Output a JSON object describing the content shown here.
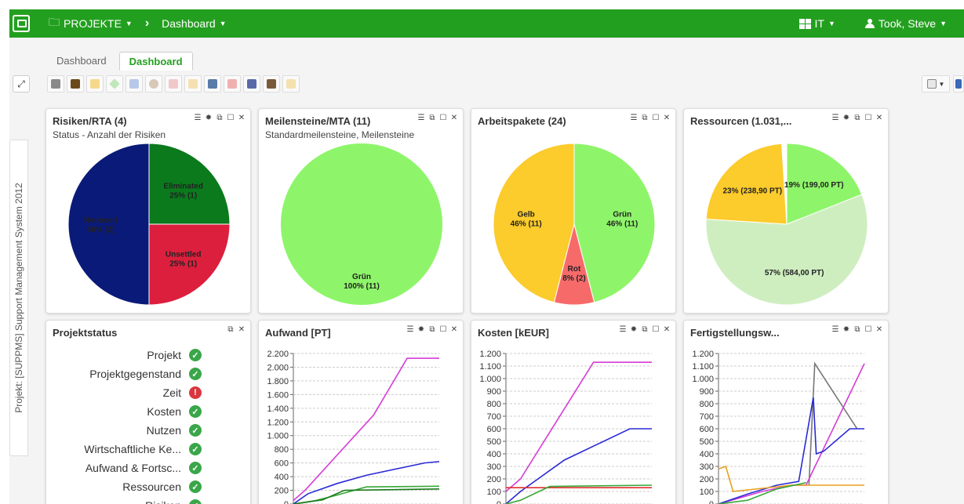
{
  "topbar": {
    "projects": "PROJEKTE",
    "dashboard": "Dashboard",
    "it": "IT",
    "user": "Took, Steve"
  },
  "tabs": [
    "Dashboard",
    "Dashboard"
  ],
  "side_tab": "Projekt: [SUPPMS] Support Management System 2012",
  "widgets": {
    "risks": {
      "title": "Risiken/RTA (4)",
      "subtitle": "Status - Anzahl der Risiken"
    },
    "milestones": {
      "title": "Meilensteine/MTA (11)",
      "subtitle": "Standardmeilensteine, Meilensteine"
    },
    "workpackages": {
      "title": "Arbeitspakete (24)"
    },
    "resources": {
      "title": "Ressourcen (1.031,..."
    },
    "projectstatus": {
      "title": "Projektstatus"
    },
    "effort": {
      "title": "Aufwand [PT]"
    },
    "costs": {
      "title": "Kosten [kEUR]"
    },
    "completion": {
      "title": "Fertigstellungsw..."
    }
  },
  "pies": {
    "risks": [
      {
        "label": "Eliminated",
        "value": "25% (1)",
        "color": "#0b7a1d",
        "frac": 0.25
      },
      {
        "label": "Unsettled",
        "value": "25% (1)",
        "color": "#dc1f3d",
        "frac": 0.25
      },
      {
        "label": "Reduced",
        "value": "50% (2)",
        "color": "#0a1a78",
        "frac": 0.5
      }
    ],
    "milestones": [
      {
        "label": "Grün",
        "value": "100% (11)",
        "color": "#8ef56a",
        "frac": 1.0
      }
    ],
    "workpackages": [
      {
        "label": "Grün",
        "value": "46% (11)",
        "color": "#8ef56a",
        "frac": 0.46
      },
      {
        "label": "Rot",
        "value": "8% (2)",
        "color": "#f76a6a",
        "frac": 0.08
      },
      {
        "label": "Gelb",
        "value": "46% (11)",
        "color": "#fccb2c",
        "frac": 0.46
      }
    ],
    "resources": [
      {
        "label": "",
        "value": "19% (199,00 PT)",
        "color": "#8ef56a",
        "frac": 0.19
      },
      {
        "label": "",
        "value": "57% (584,00 PT)",
        "color": "#cfeec0",
        "frac": 0.57
      },
      {
        "label": "",
        "value": "23% (238,90 PT)",
        "color": "#fccb2c",
        "frac": 0.23
      }
    ]
  },
  "status_items": [
    {
      "label": "Projekt",
      "state": "ok"
    },
    {
      "label": "Projektgegenstand",
      "state": "ok"
    },
    {
      "label": "Zeit",
      "state": "error"
    },
    {
      "label": "Kosten",
      "state": "ok"
    },
    {
      "label": "Nutzen",
      "state": "ok"
    },
    {
      "label": "Wirtschaftliche Ke...",
      "state": "ok"
    },
    {
      "label": "Aufwand & Fortsc...",
      "state": "ok"
    },
    {
      "label": "Ressourcen",
      "state": "ok"
    },
    {
      "label": "Risiken",
      "state": "ok"
    }
  ],
  "chart_data": [
    {
      "type": "line",
      "title": "Aufwand [PT]",
      "yticks": [
        "2.200",
        "2.000",
        "1.800",
        "1.600",
        "1.400",
        "1.200",
        "1.000",
        "800",
        "600",
        "400",
        "200",
        "0"
      ],
      "ylim": [
        0,
        2200
      ],
      "series": [
        {
          "color": "#d63bd6",
          "x": [
            0,
            0.08,
            0.55,
            0.78,
            1
          ],
          "y": [
            50,
            200,
            1300,
            2130,
            2130
          ]
        },
        {
          "color": "#2a2ad6",
          "x": [
            0,
            0.1,
            0.3,
            0.5,
            0.9,
            1
          ],
          "y": [
            0,
            150,
            300,
            420,
            600,
            620
          ]
        },
        {
          "color": "#38a838",
          "x": [
            0,
            0.15,
            0.3,
            0.5,
            1
          ],
          "y": [
            0,
            50,
            130,
            250,
            260
          ]
        },
        {
          "color": "#1a7a1a",
          "x": [
            0,
            0.2,
            0.35,
            1
          ],
          "y": [
            0,
            60,
            200,
            220
          ]
        }
      ]
    },
    {
      "type": "line",
      "title": "Kosten [kEUR]",
      "yticks": [
        "1.200",
        "1.100",
        "1.000",
        "900",
        "800",
        "700",
        "600",
        "500",
        "400",
        "300",
        "200",
        "100",
        "0"
      ],
      "ylim": [
        0,
        1200
      ],
      "series": [
        {
          "color": "#d63bd6",
          "x": [
            0,
            0.1,
            0.6,
            1
          ],
          "y": [
            100,
            200,
            1130,
            1130
          ]
        },
        {
          "color": "#2a2ad6",
          "x": [
            0,
            0.1,
            0.4,
            0.85,
            1
          ],
          "y": [
            0,
            100,
            350,
            600,
            600
          ]
        },
        {
          "color": "#e03030",
          "x": [
            0,
            1
          ],
          "y": [
            130,
            130
          ]
        },
        {
          "color": "#38a838",
          "x": [
            0,
            0.1,
            0.3,
            1
          ],
          "y": [
            0,
            30,
            140,
            150
          ]
        }
      ]
    },
    {
      "type": "line",
      "title": "Fertigstellungsw...",
      "yticks": [
        "1.200",
        "1.100",
        "1.000",
        "900",
        "800",
        "700",
        "600",
        "500",
        "400",
        "300",
        "200",
        "100",
        "0"
      ],
      "ylim": [
        0,
        1200
      ],
      "series": [
        {
          "color": "#777777",
          "x": [
            0.62,
            0.66,
            0.95
          ],
          "y": [
            150,
            1120,
            600
          ]
        },
        {
          "color": "#d63bd6",
          "x": [
            0,
            0.3,
            0.5,
            0.6,
            1
          ],
          "y": [
            0,
            100,
            150,
            150,
            1120
          ]
        },
        {
          "color": "#2a2ad6",
          "x": [
            0,
            0.2,
            0.4,
            0.55,
            0.65,
            0.67,
            0.72,
            0.9,
            1
          ],
          "y": [
            0,
            80,
            150,
            180,
            850,
            400,
            420,
            600,
            600
          ]
        },
        {
          "color": "#e8a020",
          "x": [
            0,
            0.05,
            0.1,
            0.5,
            1
          ],
          "y": [
            280,
            300,
            100,
            150,
            150
          ]
        },
        {
          "color": "#38a838",
          "x": [
            0,
            0.2,
            0.4,
            0.6
          ],
          "y": [
            0,
            30,
            120,
            170
          ]
        }
      ]
    }
  ]
}
